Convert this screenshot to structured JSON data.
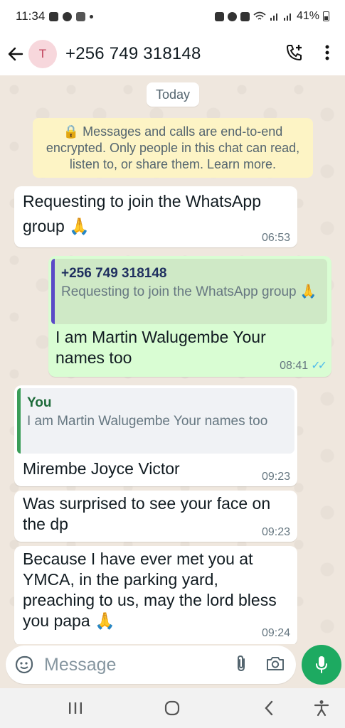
{
  "status_bar": {
    "time": "11:34",
    "battery": "41%"
  },
  "header": {
    "avatar_letter": "T",
    "contact_name": "+256 749 318148",
    "back_icon": "arrow-left-icon",
    "call_icon": "add-call-icon",
    "menu_icon": "more-vertical-icon"
  },
  "chat": {
    "date_chip": "Today",
    "encryption_notice": "🔒 Messages and calls are end-to-end encrypted. Only people in this chat can read, listen to, or share them. Learn more.",
    "messages": [
      {
        "direction": "incoming",
        "text": "Requesting to join the WhatsApp group 🙏",
        "time": "06:53"
      },
      {
        "direction": "outgoing",
        "quote_author": "+256 749 318148",
        "quote_text": "Requesting to join the WhatsApp group 🙏",
        "text": "I am Martin Walugembe Your names too",
        "time": "08:41",
        "ticks": "✓✓"
      },
      {
        "direction": "incoming",
        "quote_author": "You",
        "quote_text": "I am Martin Walugembe Your names too",
        "text": "Mirembe Joyce Victor",
        "time": "09:23"
      },
      {
        "direction": "incoming",
        "text": "Was surprised to see your face on the dp",
        "time": "09:23"
      },
      {
        "direction": "incoming",
        "text": "Because I have ever met you at YMCA, in the parking yard, preaching to us, may the lord bless you papa 🙏",
        "time": "09:24"
      }
    ]
  },
  "composer": {
    "placeholder": "Message",
    "emoji_icon": "sticker-icon",
    "attach_icon": "paperclip-icon",
    "camera_icon": "camera-icon",
    "mic_icon": "mic-icon"
  },
  "colors": {
    "outgoing_bubble": "#d9fdd3",
    "incoming_bubble": "#ffffff",
    "accent": "#1daa61",
    "chat_bg": "#efe7de"
  }
}
